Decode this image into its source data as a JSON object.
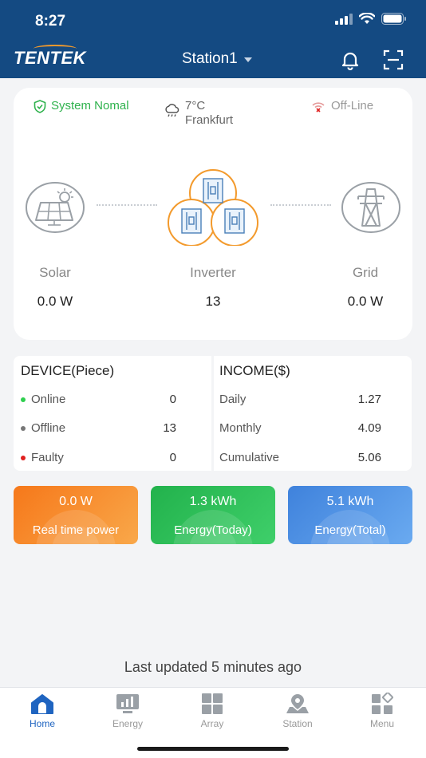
{
  "status_bar": {
    "time": "8:27"
  },
  "header": {
    "logo": "TENTEK",
    "station": "Station1"
  },
  "overview": {
    "system_status": "System Nomal",
    "weather": {
      "temp": "7°C",
      "city": "Frankfurt"
    },
    "connection": "Off-Line",
    "solar": {
      "label": "Solar",
      "value": "0.0 W"
    },
    "inverter": {
      "label": "Inverter",
      "value": "13"
    },
    "grid": {
      "label": "Grid",
      "value": "0.0 W"
    }
  },
  "device": {
    "title": "DEVICE(Piece)",
    "rows": [
      {
        "label": "Online",
        "value": "0",
        "color": "#2fcf4f"
      },
      {
        "label": "Offline",
        "value": "13",
        "color": "#777777"
      },
      {
        "label": "Faulty",
        "value": "0",
        "color": "#e0201f"
      }
    ]
  },
  "income": {
    "title": "INCOME($)",
    "rows": [
      {
        "label": "Daily",
        "value": "1.27"
      },
      {
        "label": "Monthly",
        "value": "4.09"
      },
      {
        "label": "Cumulative",
        "value": "5.06"
      }
    ]
  },
  "metrics": [
    {
      "value": "0.0 W",
      "label": "Real time power"
    },
    {
      "value": "1.3 kWh",
      "label": "Energy(Today)"
    },
    {
      "value": "5.1 kWh",
      "label": "Energy(Total)"
    }
  ],
  "last_updated": "Last updated 5 minutes ago",
  "tabs": [
    {
      "label": "Home",
      "icon": "home-icon",
      "active": true
    },
    {
      "label": "Energy",
      "icon": "energy-icon",
      "active": false
    },
    {
      "label": "Array",
      "icon": "array-icon",
      "active": false
    },
    {
      "label": "Station",
      "icon": "station-icon",
      "active": false
    },
    {
      "label": "Menu",
      "icon": "menu-icon",
      "active": false
    }
  ],
  "colors": {
    "header": "#144a82",
    "accent_orange": "#f39a2c",
    "status_green": "#2fb24d",
    "tab_active": "#1f64c0"
  }
}
